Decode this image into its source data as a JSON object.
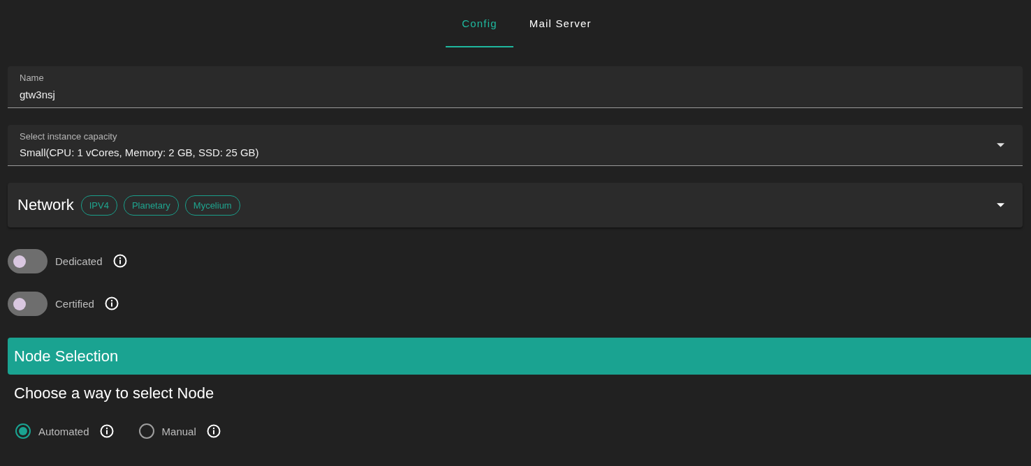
{
  "tabs": [
    {
      "label": "Config",
      "selected": true
    },
    {
      "label": "Mail Server",
      "selected": false
    }
  ],
  "name_field": {
    "label": "Name",
    "value": "gtw3nsj"
  },
  "capacity_select": {
    "label": "Select instance capacity",
    "value": "Small(CPU: 1 vCores, Memory: 2 GB, SSD: 25 GB)"
  },
  "network": {
    "title": "Network",
    "expanded": false,
    "chips": [
      "IPV4",
      "Planetary",
      "Mycelium"
    ]
  },
  "switches": [
    {
      "label": "Dedicated",
      "on": false
    },
    {
      "label": "Certified",
      "on": false
    }
  ],
  "node_selection": {
    "title": "Node Selection",
    "subtitle": "Choose a way to select Node",
    "options": [
      {
        "label": "Automated",
        "selected": true
      },
      {
        "label": "Manual",
        "selected": false
      }
    ]
  }
}
